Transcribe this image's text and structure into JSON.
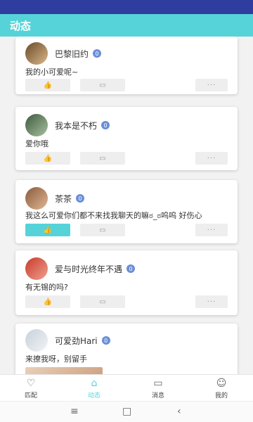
{
  "app": {
    "title": "动态"
  },
  "feed": [
    {
      "username": "巴黎旧约",
      "level": "0",
      "text": "我的小可爱呢~",
      "liked": false,
      "avatar_color": "#7a5a3a"
    },
    {
      "username": "我本是不朽",
      "level": "0",
      "text": "爱你哦",
      "liked": false,
      "avatar_color": "#4a6a4a"
    },
    {
      "username": "茶茶",
      "level": "0",
      "text": "我这么可爱你们都不来找我聊天的嘛ಠ_ಠ呜呜 好伤心",
      "liked": true,
      "avatar_color": "#8a5a3a"
    },
    {
      "username": "爱与时光终年不遇",
      "level": "0",
      "text": "有无锡的吗?",
      "liked": false,
      "avatar_color": "#c84a3a"
    },
    {
      "username": "可爱劲Hari",
      "level": "0",
      "text": "来撩我呀，别留手",
      "liked": false,
      "avatar_color": "#d8dfe6"
    }
  ],
  "actions": {
    "like": "👍",
    "comment": "▭",
    "more": "···"
  },
  "tabs": [
    {
      "label": "匹配",
      "icon": "heart-icon",
      "glyph": "♡"
    },
    {
      "label": "动态",
      "icon": "home-icon",
      "glyph": "⌂"
    },
    {
      "label": "消息",
      "icon": "message-icon",
      "glyph": "▭"
    },
    {
      "label": "我的",
      "icon": "profile-icon",
      "glyph": "☺"
    }
  ],
  "active_tab": "动态",
  "colors": {
    "accent": "#56d3d8",
    "status_bar": "#2f3e9e",
    "level_badge": "#6a8fd8"
  },
  "system_nav": {
    "menu": "≡",
    "home": "□",
    "back": "‹"
  }
}
